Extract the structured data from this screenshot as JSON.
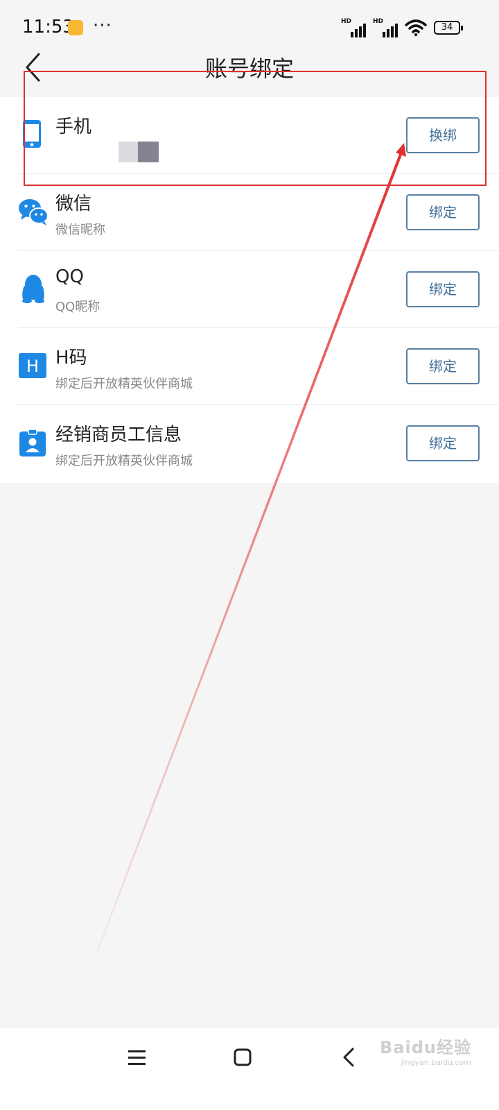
{
  "status_bar": {
    "time": "11:53",
    "dots": "···",
    "signal_1_label": "HD",
    "signal_2_label": "HD",
    "battery_level": "34",
    "app_icon": "gallery-app-icon"
  },
  "header": {
    "title": "账号绑定",
    "back_icon": "chevron-left-icon"
  },
  "accounts": [
    {
      "title": "手机",
      "subtitle": "",
      "button": "换绑",
      "icon": "phone-icon",
      "icon_color": "#1e88e5"
    },
    {
      "title": "微信",
      "subtitle": "微信昵称",
      "button": "绑定",
      "icon": "wechat-icon",
      "icon_color": "#1e88e5"
    },
    {
      "title": "QQ",
      "subtitle": "QQ昵称",
      "button": "绑定",
      "icon": "qq-penguin-icon",
      "icon_color": "#1e88e5"
    },
    {
      "title": "H码",
      "subtitle": "绑定后开放精英伙伴商城",
      "button": "绑定",
      "icon": "h-code-icon",
      "icon_color": "#1e88e5"
    },
    {
      "title": "经销商员工信息",
      "subtitle": "绑定后开放精英伙伴商城",
      "button": "绑定",
      "icon": "employee-badge-icon",
      "icon_color": "#1e88e5"
    }
  ],
  "h_code_icon_letter": "H",
  "nav_bar": {
    "menu_icon": "menu-icon",
    "home_icon": "home-square-icon",
    "back_icon": "back-chevron-icon"
  },
  "watermark": {
    "main": "Baidu经验",
    "url": "jingyan.baidu.com"
  },
  "colors": {
    "accent": "#1e88e5",
    "button_border": "#5a7fa3",
    "button_text": "#3f6e99",
    "annotation": "#e03030",
    "background": "#f5f5f5"
  }
}
